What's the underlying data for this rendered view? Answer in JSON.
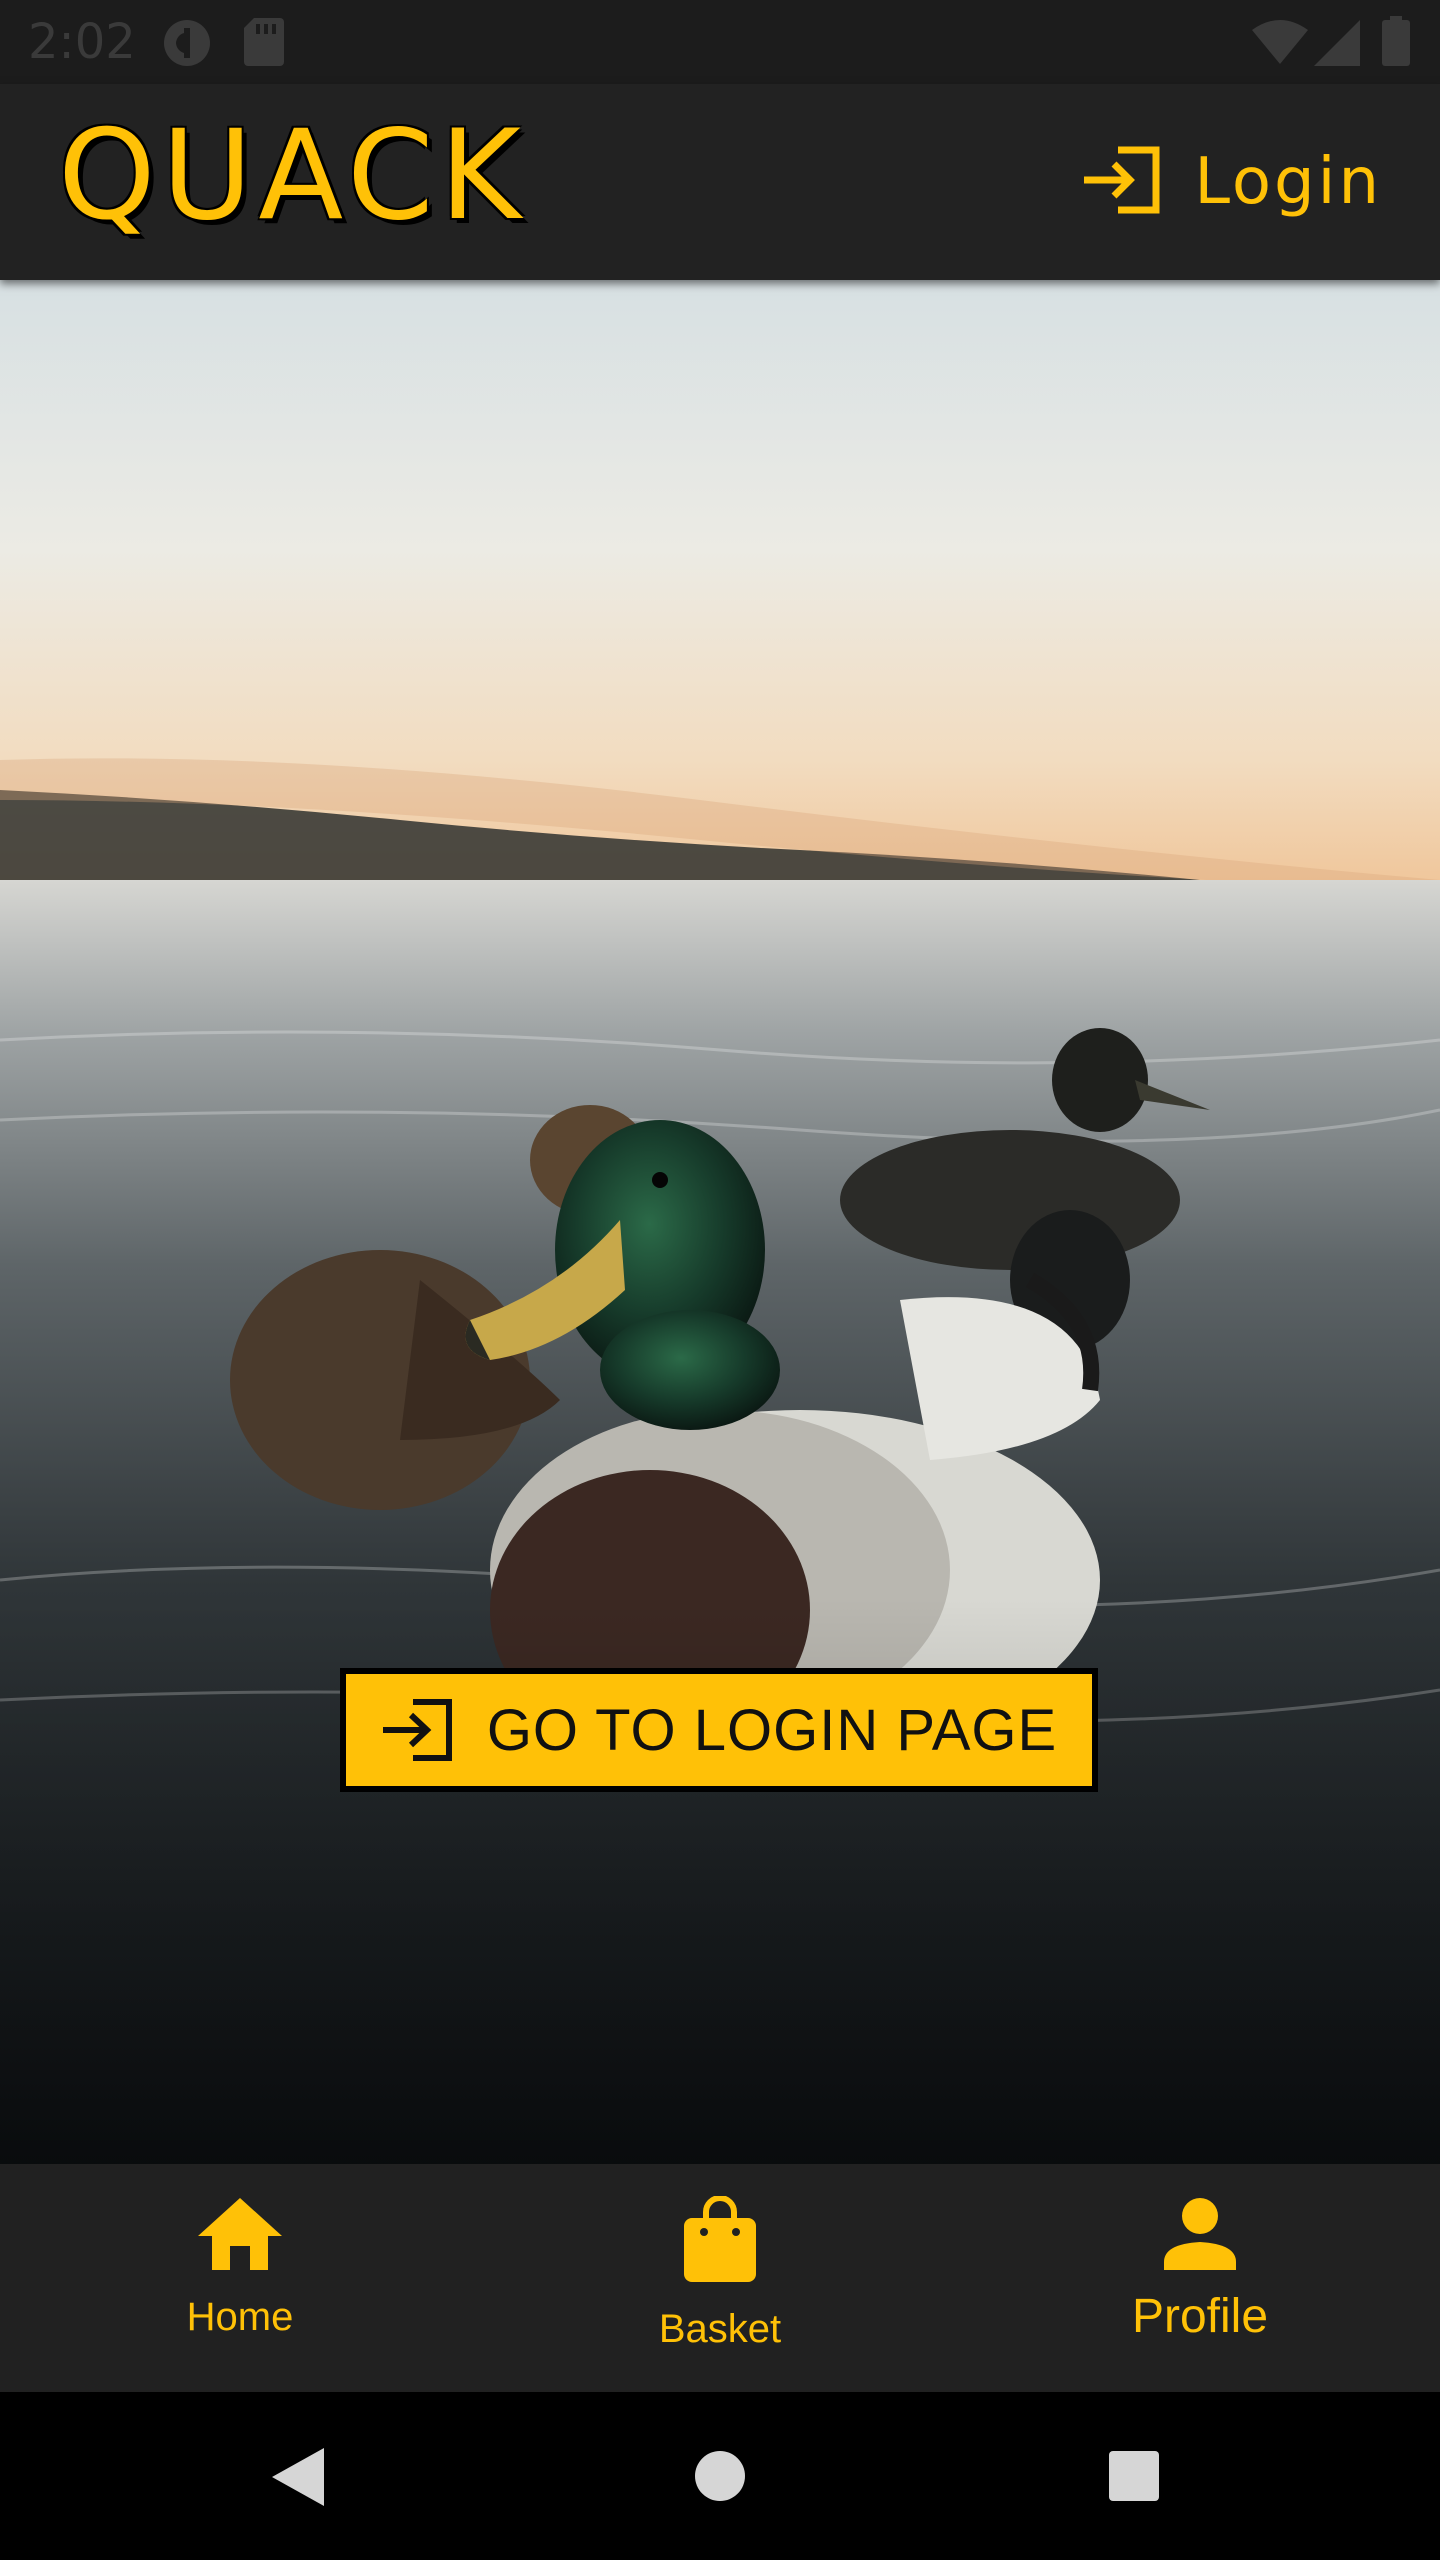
{
  "status_bar": {
    "time": "2:02",
    "icons": [
      "app-notification-icon",
      "sd-card-icon",
      "wifi-icon",
      "cellular-signal-icon",
      "battery-icon"
    ]
  },
  "app_bar": {
    "title": "QUACK",
    "login_label": "Login",
    "login_icon": "login-icon"
  },
  "hero": {
    "image_description_icon": "ducks-photo",
    "button_label": "GO TO LOGIN PAGE",
    "button_icon": "login-icon"
  },
  "bottom_nav": {
    "items": [
      {
        "label": "Home",
        "icon": "home-icon"
      },
      {
        "label": "Basket",
        "icon": "shopping-bag-icon"
      },
      {
        "label": "Profile",
        "icon": "person-icon"
      }
    ],
    "active_index": 2
  },
  "system_nav": {
    "buttons": [
      "back-icon",
      "home-circle-icon",
      "recents-icon"
    ]
  },
  "colors": {
    "accent": "#FFC107",
    "app_bar": "#222222",
    "bottom_nav": "#212121",
    "status_bar": "#1c1c1c"
  }
}
